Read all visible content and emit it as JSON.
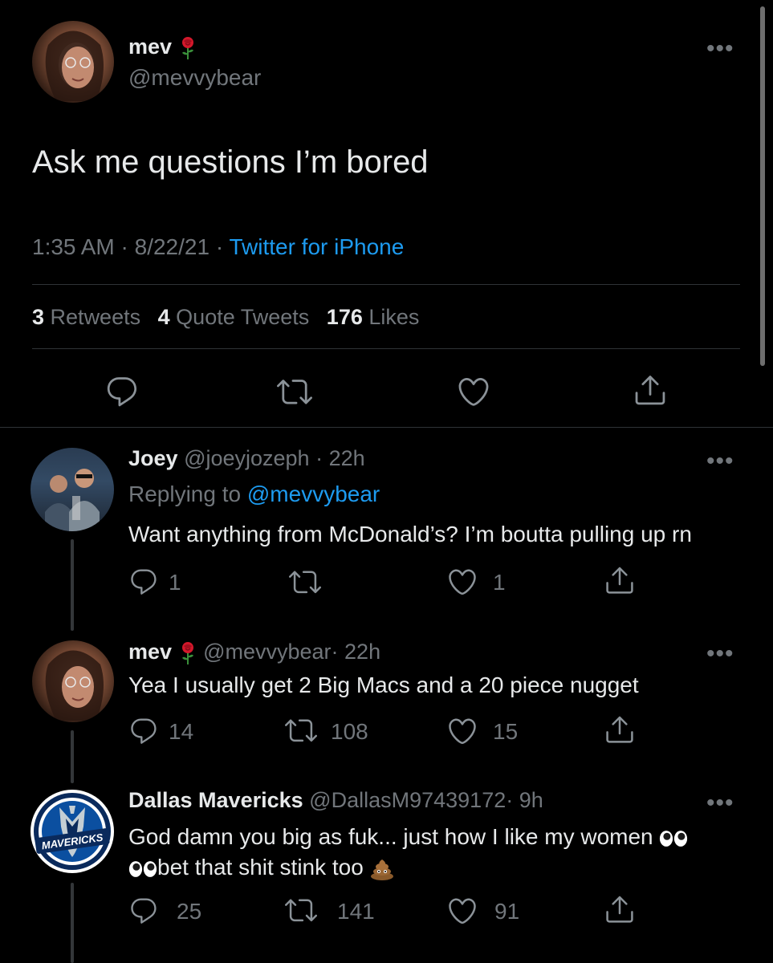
{
  "main_tweet": {
    "display_name": "mev",
    "handle": "@mevvybear",
    "text": "Ask me questions I’m bored",
    "time": "1:35 AM",
    "date": "8/22/21",
    "source": "Twitter for iPhone",
    "separator": "·",
    "stats": {
      "retweets_count": "3",
      "retweets_label": "Retweets",
      "quotes_count": "4",
      "quotes_label": "Quote Tweets",
      "likes_count": "176",
      "likes_label": "Likes"
    }
  },
  "replies": [
    {
      "display_name": "Joey",
      "handle": "@joeyjozeph",
      "time": "· 22h",
      "replying_prefix": "Replying to",
      "replying_to": "@mevvybear",
      "text": "Want anything from McDonald’s? I’m boutta pulling up rn",
      "reply_count": "1",
      "retweet_count": "",
      "like_count": "1"
    },
    {
      "display_name": "mev",
      "handle": "@mevvybear",
      "time": "· 22h",
      "text": "Yea I usually get 2 Big Macs and a 20 piece nugget",
      "reply_count": "14",
      "retweet_count": "108",
      "like_count": "15"
    },
    {
      "display_name": "Dallas Mavericks",
      "handle": "@DallasM97439172",
      "time": "· 9h",
      "text_line1": "God damn you big as fuk... just how I like my women",
      "text_line2": "bet that shit stink too",
      "reply_count": "25",
      "retweet_count": "141",
      "like_count": "91",
      "avatar_text": "MAVERICKS"
    }
  ],
  "colors": {
    "background": "#000000",
    "text": "#e7e9ea",
    "muted": "#71767b",
    "link": "#1d9bf0",
    "divider": "#2f3336"
  },
  "icons": [
    "more-icon",
    "reply-icon",
    "retweet-icon",
    "like-icon",
    "share-icon",
    "rose-emoji",
    "eyes-emoji",
    "poop-emoji"
  ]
}
